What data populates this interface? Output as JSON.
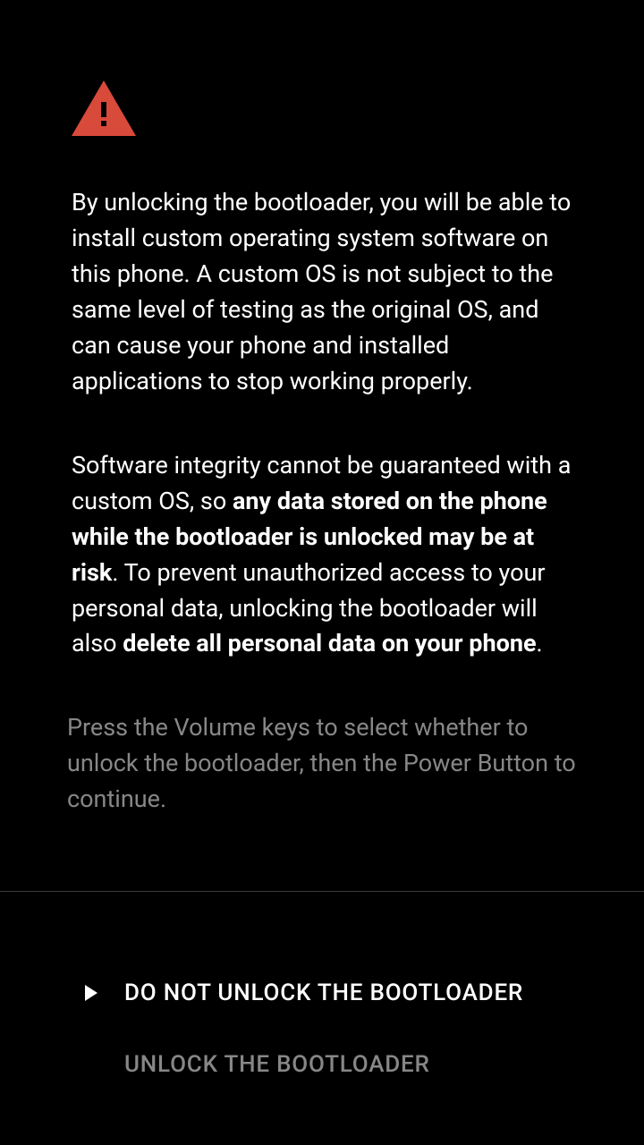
{
  "warning": {
    "para1": "By unlocking the bootloader, you will be able to install custom operating system software on this phone. A custom OS is not subject to the same level of testing as the original OS, and can cause your phone and installed applications to stop working properly.",
    "para2_prefix": "Software integrity cannot be guaranteed with a custom OS, so ",
    "para2_bold1": "any data stored on the phone while the bootloader is unlocked may be at risk",
    "para2_mid": ". To prevent unauthorized access to your personal data, unlocking the bootloader will also ",
    "para2_bold2": "delete all personal data on your phone",
    "para2_suffix": "."
  },
  "instruction": "Press the Volume keys to select whether to unlock the bootloader, then the Power Button to continue.",
  "options": {
    "do_not_unlock": "DO NOT UNLOCK THE BOOTLOADER",
    "unlock": "UNLOCK THE BOOTLOADER"
  }
}
